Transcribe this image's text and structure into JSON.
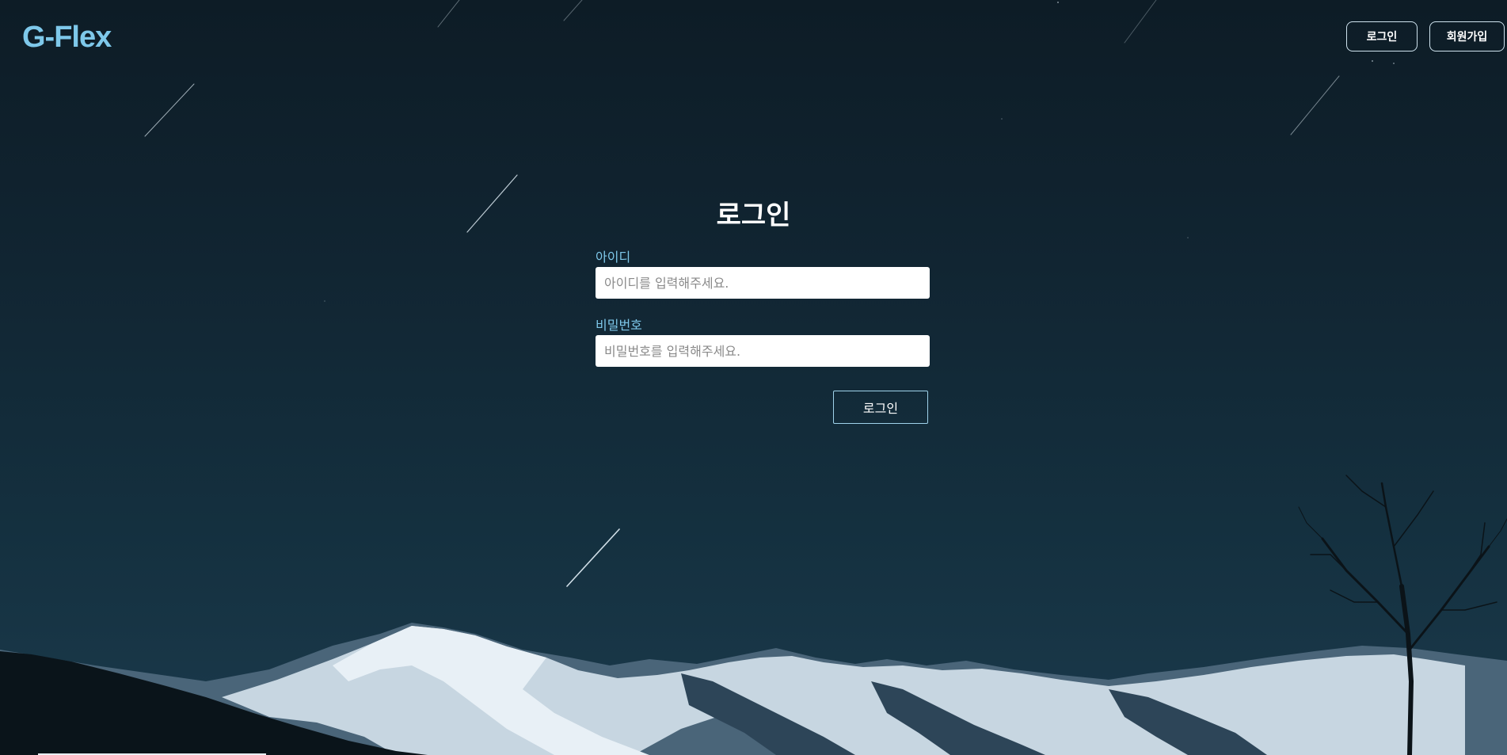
{
  "brand": {
    "logo_text": "G-Flex",
    "accent": "#7ec8ea"
  },
  "header": {
    "login_label": "로그인",
    "signup_label": "회원가입"
  },
  "login_form": {
    "title": "로그인",
    "id_label": "아이디",
    "id_placeholder": "아이디를 입력해주세요.",
    "id_value": "",
    "password_label": "비밀번호",
    "password_placeholder": "비밀번호를 입력해주세요.",
    "password_value": "",
    "submit_label": "로그인"
  },
  "background": {
    "theme": "night-sky-mountains",
    "sky_color": "#112532",
    "snow_color": "#d9e6ef"
  }
}
